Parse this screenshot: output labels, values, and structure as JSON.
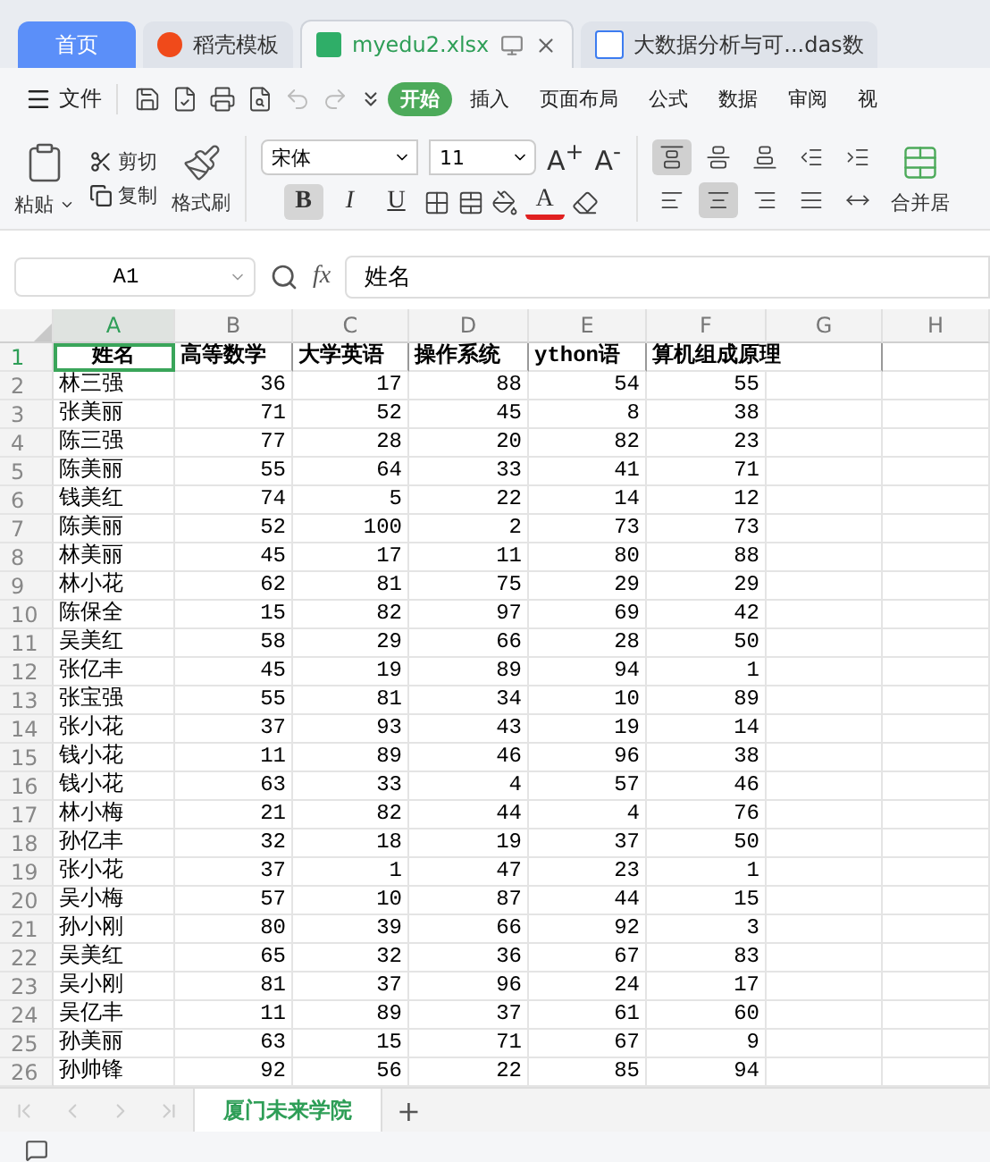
{
  "tabs": [
    {
      "label": "首页",
      "kind": "home",
      "selected": false
    },
    {
      "label": "稻壳模板",
      "kind": "template",
      "selected": false
    },
    {
      "label": "myedu2.xlsx",
      "kind": "sheet",
      "selected": true
    },
    {
      "label": "大数据分析与可...das数",
      "kind": "doc",
      "selected": false
    }
  ],
  "menu": {
    "file": "文件",
    "items": [
      {
        "label": "开始",
        "selected": true
      },
      {
        "label": "插入",
        "selected": false
      },
      {
        "label": "页面布局",
        "selected": false
      },
      {
        "label": "公式",
        "selected": false
      },
      {
        "label": "数据",
        "selected": false
      },
      {
        "label": "审阅",
        "selected": false
      },
      {
        "label": "视",
        "selected": false
      }
    ]
  },
  "function_label": "fx",
  "ribbon": {
    "paste": "粘贴",
    "cut": "剪切",
    "copy": "复制",
    "format_painter": "格式刷",
    "font": "宋体",
    "size": "11",
    "grow": "A$^{+}$",
    "shrink": "A$^{-}$",
    "format_buttons": [
      {
        "label": "B",
        "selected": true
      },
      {
        "label": "I",
        "selected": false
      },
      {
        "label": "U",
        "selected": false
      }
    ],
    "font_color": "A",
    "align_buttons": [
      {
        "kind": "top",
        "selected": true
      },
      {
        "kind": "middle",
        "selected": false
      },
      {
        "kind": "bottom",
        "selected": false
      },
      {
        "kind": "outdent",
        "selected": false
      },
      {
        "kind": "indent",
        "selected": false
      },
      {
        "kind": "left",
        "selected": false
      },
      {
        "kind": "center",
        "selected": true
      },
      {
        "kind": "right",
        "selected": false
      },
      {
        "kind": "justify",
        "selected": false
      },
      {
        "kind": "distribute",
        "selected": false
      }
    ],
    "merge": "合并居"
  },
  "name_box": "A1",
  "formula": "姓名",
  "columns": [
    {
      "label": "A",
      "selected": true
    },
    {
      "label": "B",
      "selected": false
    },
    {
      "label": "C",
      "selected": false
    },
    {
      "label": "D",
      "selected": false
    },
    {
      "label": "E",
      "selected": false
    },
    {
      "label": "F",
      "selected": false
    },
    {
      "label": "G",
      "selected": false
    },
    {
      "label": "H",
      "selected": false
    }
  ],
  "rows": [
    {
      "number": "1",
      "selected": true,
      "header": true,
      "cells": [
        "姓名",
        "高等数学",
        "大学英语",
        "操作系统",
        "ython语",
        "算机组成原理"
      ]
    },
    {
      "number": "2",
      "selected": false,
      "header": false,
      "cells": [
        "林三强",
        "36",
        "17",
        "88",
        "54",
        "55"
      ]
    },
    {
      "number": "3",
      "selected": false,
      "header": false,
      "cells": [
        "张美丽",
        "71",
        "52",
        "45",
        "8",
        "38"
      ]
    },
    {
      "number": "4",
      "selected": false,
      "header": false,
      "cells": [
        "陈三强",
        "77",
        "28",
        "20",
        "82",
        "23"
      ]
    },
    {
      "number": "5",
      "selected": false,
      "header": false,
      "cells": [
        "陈美丽",
        "55",
        "64",
        "33",
        "41",
        "71"
      ]
    },
    {
      "number": "6",
      "selected": false,
      "header": false,
      "cells": [
        "钱美红",
        "74",
        "5",
        "22",
        "14",
        "12"
      ]
    },
    {
      "number": "7",
      "selected": false,
      "header": false,
      "cells": [
        "陈美丽",
        "52",
        "100",
        "2",
        "73",
        "73"
      ]
    },
    {
      "number": "8",
      "selected": false,
      "header": false,
      "cells": [
        "林美丽",
        "45",
        "17",
        "11",
        "80",
        "88"
      ]
    },
    {
      "number": "9",
      "selected": false,
      "header": false,
      "cells": [
        "林小花",
        "62",
        "81",
        "75",
        "29",
        "29"
      ]
    },
    {
      "number": "10",
      "selected": false,
      "header": false,
      "cells": [
        "陈保全",
        "15",
        "82",
        "97",
        "69",
        "42"
      ]
    },
    {
      "number": "11",
      "selected": false,
      "header": false,
      "cells": [
        "吴美红",
        "58",
        "29",
        "66",
        "28",
        "50"
      ]
    },
    {
      "number": "12",
      "selected": false,
      "header": false,
      "cells": [
        "张亿丰",
        "45",
        "19",
        "89",
        "94",
        "1"
      ]
    },
    {
      "number": "13",
      "selected": false,
      "header": false,
      "cells": [
        "张宝强",
        "55",
        "81",
        "34",
        "10",
        "89"
      ]
    },
    {
      "number": "14",
      "selected": false,
      "header": false,
      "cells": [
        "张小花",
        "37",
        "93",
        "43",
        "19",
        "14"
      ]
    },
    {
      "number": "15",
      "selected": false,
      "header": false,
      "cells": [
        "钱小花",
        "11",
        "89",
        "46",
        "96",
        "38"
      ]
    },
    {
      "number": "16",
      "selected": false,
      "header": false,
      "cells": [
        "钱小花",
        "63",
        "33",
        "4",
        "57",
        "46"
      ]
    },
    {
      "number": "17",
      "selected": false,
      "header": false,
      "cells": [
        "林小梅",
        "21",
        "82",
        "44",
        "4",
        "76"
      ]
    },
    {
      "number": "18",
      "selected": false,
      "header": false,
      "cells": [
        "孙亿丰",
        "32",
        "18",
        "19",
        "37",
        "50"
      ]
    },
    {
      "number": "19",
      "selected": false,
      "header": false,
      "cells": [
        "张小花",
        "37",
        "1",
        "47",
        "23",
        "1"
      ]
    },
    {
      "number": "20",
      "selected": false,
      "header": false,
      "cells": [
        "吴小梅",
        "57",
        "10",
        "87",
        "44",
        "15"
      ]
    },
    {
      "number": "21",
      "selected": false,
      "header": false,
      "cells": [
        "孙小刚",
        "80",
        "39",
        "66",
        "92",
        "3"
      ]
    },
    {
      "number": "22",
      "selected": false,
      "header": false,
      "cells": [
        "吴美红",
        "65",
        "32",
        "36",
        "67",
        "83"
      ]
    },
    {
      "number": "23",
      "selected": false,
      "header": false,
      "cells": [
        "吴小刚",
        "81",
        "37",
        "96",
        "24",
        "17"
      ]
    },
    {
      "number": "24",
      "selected": false,
      "header": false,
      "cells": [
        "吴亿丰",
        "11",
        "89",
        "37",
        "61",
        "60"
      ]
    },
    {
      "number": "25",
      "selected": false,
      "header": false,
      "cells": [
        "孙美丽",
        "63",
        "15",
        "71",
        "67",
        "9"
      ]
    },
    {
      "number": "26",
      "selected": false,
      "header": false,
      "cells": [
        "孙帅锋",
        "92",
        "56",
        "22",
        "85",
        "94"
      ]
    }
  ],
  "sheets": [
    {
      "label": "厦门未来学院",
      "selected": true
    }
  ],
  "add_sheet": "+"
}
